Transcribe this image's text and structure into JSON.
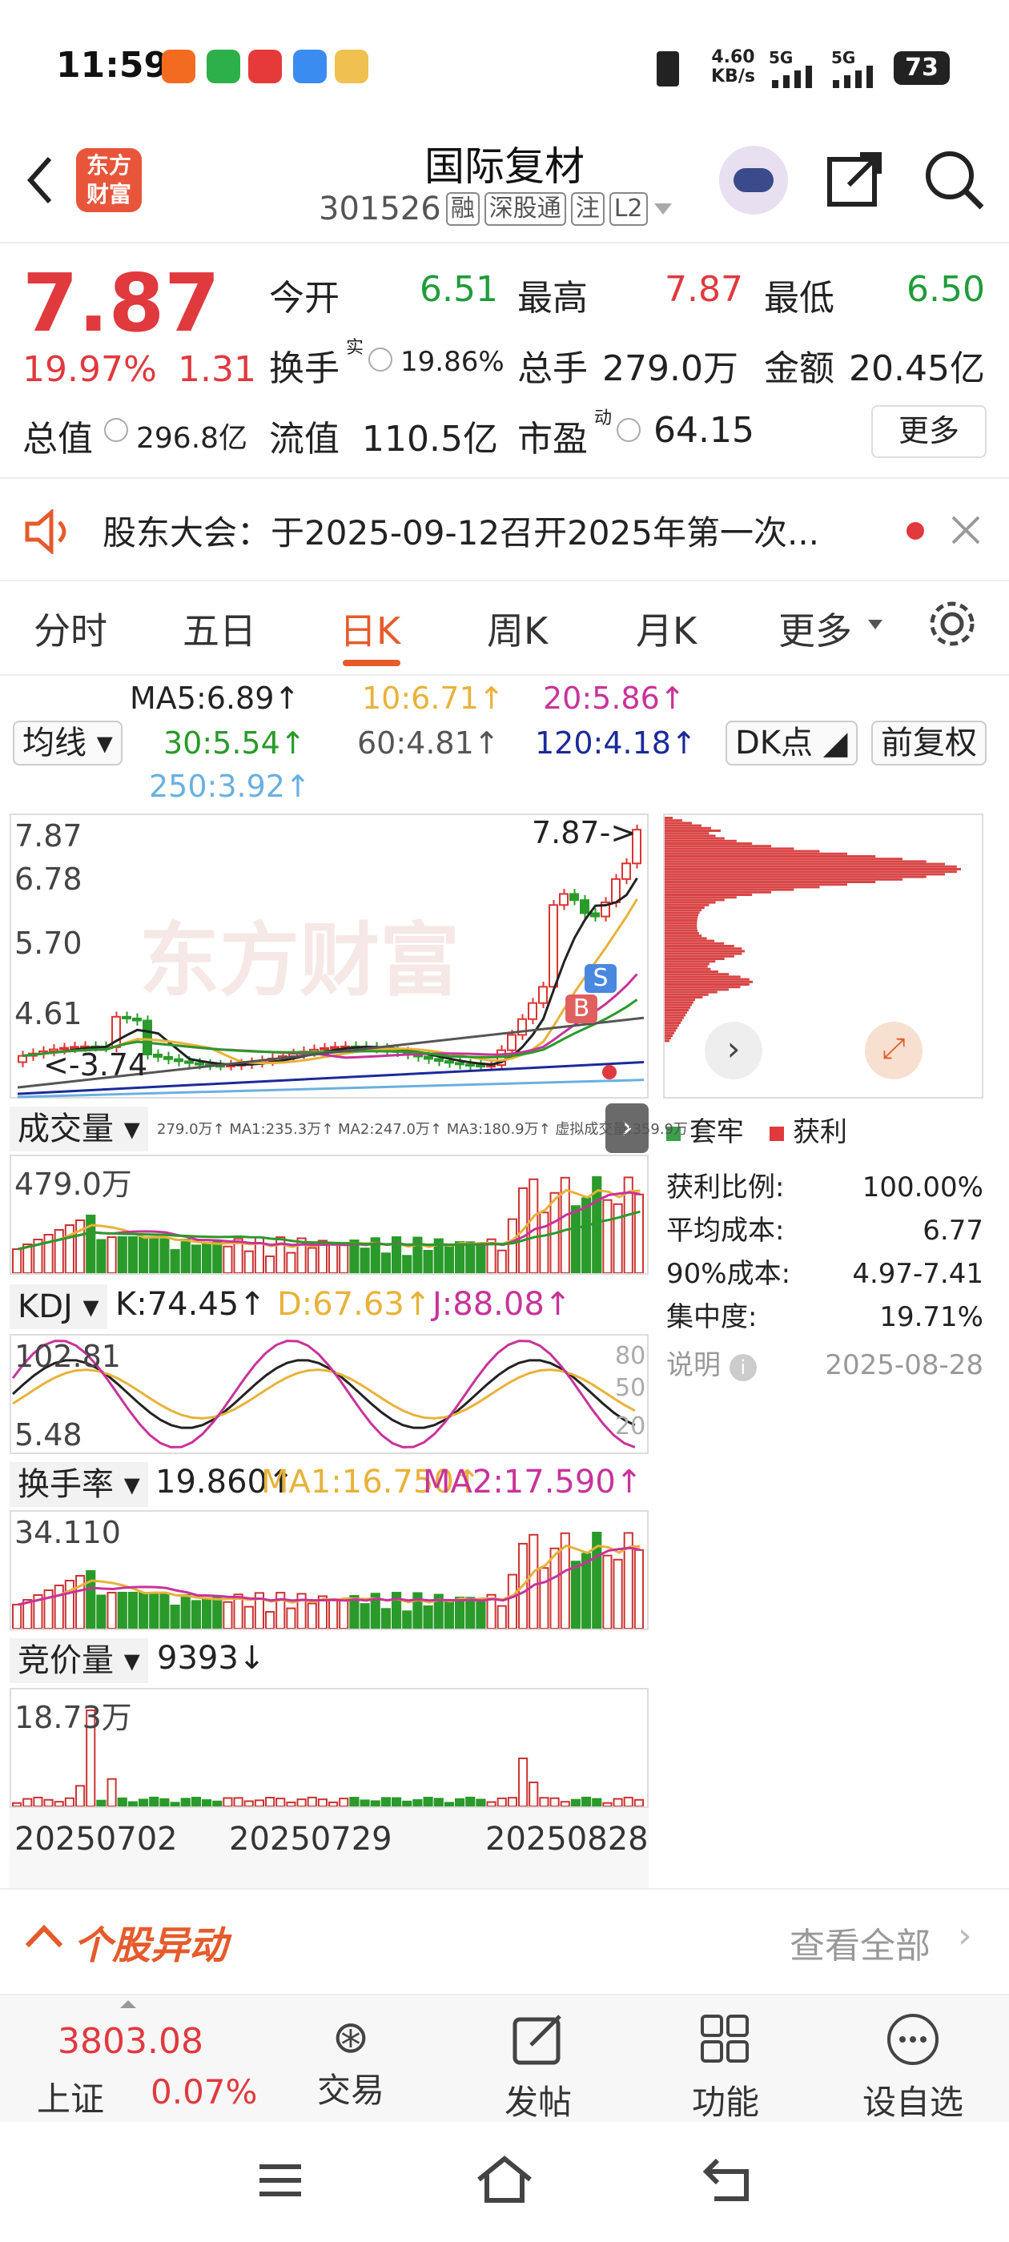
{
  "status_bar": {
    "time": "11:59",
    "speed": "4.60",
    "speed_unit": "KB/s",
    "net1": "5G",
    "net2": "5G",
    "battery": "73"
  },
  "header": {
    "title": "国际复材",
    "code": "301526",
    "tags": [
      "融",
      "深股通",
      "注",
      "L2"
    ],
    "logo_line1": "东方",
    "logo_line2": "财富"
  },
  "quote": {
    "price": "7.87",
    "change_pct": "19.97%",
    "change": "1.31",
    "open_label": "今开",
    "open": "6.51",
    "high_label": "最高",
    "high": "7.87",
    "low_label": "最低",
    "low": "6.50",
    "turnover_label": "换手",
    "turnover_sup": "实",
    "turnover": "19.86%",
    "volume_label": "总手",
    "volume": "279.0万",
    "amount_label": "金额",
    "amount": "20.45亿",
    "mcap_label": "总值",
    "mcap": "296.8亿",
    "float_label": "流值",
    "float": "110.5亿",
    "pe_label": "市盈",
    "pe_sup": "动",
    "pe": "64.15",
    "more": "更多"
  },
  "notice": {
    "text": "股东大会：于2025-09-12召开2025年第一次..."
  },
  "tabs": [
    "分时",
    "五日",
    "日K",
    "周K",
    "月K",
    "更多"
  ],
  "ma": {
    "btn": "均线",
    "ma5": "MA5:6.89↑",
    "ma10": "10:6.71↑",
    "ma20": "20:5.86↑",
    "ma30": "30:5.54↑",
    "ma60": "60:4.81↑",
    "ma120": "120:4.18↑",
    "ma250": "250:3.92↑",
    "dk": "DK点",
    "fq": "前复权"
  },
  "kchart": {
    "y1": "7.87",
    "y2": "6.78",
    "y3": "5.70",
    "y4": "4.61",
    "low": "3.74",
    "hi_lbl": "7.87->",
    "watermark": "东方财富"
  },
  "chip": {
    "legend1": "套牢",
    "legend2": "获利",
    "rows": [
      {
        "k": "获利比例:",
        "v": "100.00%"
      },
      {
        "k": "平均成本:",
        "v": "6.77"
      },
      {
        "k": "90%成本:",
        "v": "4.97-7.41"
      },
      {
        "k": "集中度:",
        "v": "19.71%"
      }
    ],
    "note": "说明",
    "date": "2025-08-28"
  },
  "vol": {
    "dd": "成交量",
    "small": "279.0万↑ MA1:235.3万↑ MA2:247.0万↑ MA3:180.9万↑ 虚拟成交量:359.9万",
    "ymax": "479.0万"
  },
  "kdj": {
    "dd": "KDJ",
    "k": "K:74.45↑",
    "d": "D:67.63↑",
    "j": "J:88.08↑",
    "ymax": "102.81",
    "ymin": "5.48",
    "l80": "80",
    "l50": "50",
    "l20": "20"
  },
  "hsl": {
    "dd": "换手率",
    "v": "19.860↑",
    "ma1": "MA1:16.750↑",
    "ma2": "MA2:17.590↑",
    "ymax": "34.110"
  },
  "jjl": {
    "dd": "竞价量",
    "v": "9393↓",
    "ymax": "18.73万"
  },
  "dates": [
    "20250702",
    "20250729",
    "20250828"
  ],
  "movement": {
    "title": "个股异动",
    "all": "查看全部"
  },
  "bottom": {
    "index_val": "3803.08",
    "index_name": "上证",
    "index_pct": "0.07%",
    "b1": "交易",
    "b2": "发帖",
    "b3": "功能",
    "b4": "设自选"
  }
}
